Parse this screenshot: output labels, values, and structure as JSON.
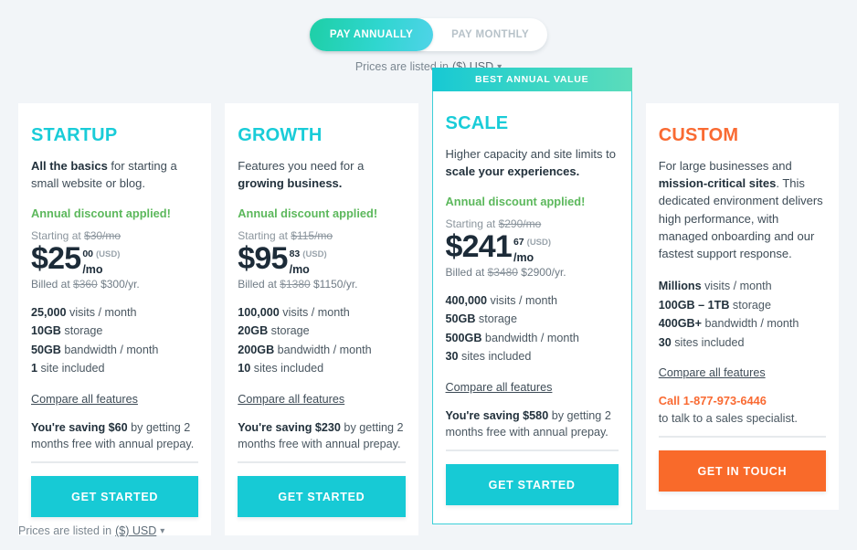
{
  "billing_toggle": {
    "annual_label": "PAY ANNUALLY",
    "monthly_label": "PAY MONTHLY",
    "active": "annual",
    "active_gradient_from": "#1ecfa6",
    "active_gradient_to": "#4fd3e8"
  },
  "currency_note_top": {
    "prefix": "Prices are listed in",
    "currency": "($) USD",
    "caret": "chevron-down"
  },
  "currency_note_bottom": {
    "prefix": "Prices are listed in",
    "currency": "($) USD",
    "caret": "chevron-down"
  },
  "colors": {
    "teal": "#19ccd8",
    "teal_button": "#17cad5",
    "orange": "#f96a32",
    "green": "#5cb85c",
    "page_bg": "#f2f5f8",
    "featured_border": "#3ccfd9"
  },
  "cards": [
    {
      "name": "STARTUP",
      "blurb_bold": "All the basics",
      "blurb_rest": " for starting a small website or blog.",
      "discount": "Annual discount applied!",
      "starting_prefix": "Starting at",
      "starting_struck": "$30/mo",
      "price_main": "$25",
      "price_cents": "00",
      "price_currency": "(USD)",
      "price_period": "/mo",
      "billed_prefix": "Billed at",
      "billed_struck": "$360",
      "billed_now": "$300/yr.",
      "specs": [
        {
          "bold": "25,000",
          "rest": " visits / month"
        },
        {
          "bold": "10GB",
          "rest": " storage"
        },
        {
          "bold": "50GB",
          "rest": " bandwidth / month"
        },
        {
          "bold": "1",
          "rest": " site included"
        }
      ],
      "compare_label": "Compare all features",
      "saving_bold": "You're saving $60",
      "saving_rest": " by getting 2 months free with annual prepay.",
      "cta_label": "GET STARTED",
      "cta_style": "teal",
      "featured": false,
      "banner": null
    },
    {
      "name": "GROWTH",
      "blurb_bold": "growing business.",
      "blurb_prefix": "Features you need for a ",
      "discount": "Annual discount applied!",
      "starting_prefix": "Starting at",
      "starting_struck": "$115/mo",
      "price_main": "$95",
      "price_cents": "83",
      "price_currency": "(USD)",
      "price_period": "/mo",
      "billed_prefix": "Billed at",
      "billed_struck": "$1380",
      "billed_now": "$1150/yr.",
      "specs": [
        {
          "bold": "100,000",
          "rest": " visits / month"
        },
        {
          "bold": "20GB",
          "rest": " storage"
        },
        {
          "bold": "200GB",
          "rest": " bandwidth / month"
        },
        {
          "bold": "10",
          "rest": " sites included"
        }
      ],
      "compare_label": "Compare all features",
      "saving_bold": "You're saving $230",
      "saving_rest": " by getting 2 months free with annual prepay.",
      "cta_label": "GET STARTED",
      "cta_style": "teal",
      "featured": false,
      "banner": null
    },
    {
      "name": "SCALE",
      "blurb_prefix": "Higher capacity and site limits to ",
      "blurb_bold": "scale your experiences.",
      "discount": "Annual discount applied!",
      "starting_prefix": "Starting at",
      "starting_struck": "$290/mo",
      "price_main": "$241",
      "price_cents": "67",
      "price_currency": "(USD)",
      "price_period": "/mo",
      "billed_prefix": "Billed at",
      "billed_struck": "$3480",
      "billed_now": "$2900/yr.",
      "specs": [
        {
          "bold": "400,000",
          "rest": " visits / month"
        },
        {
          "bold": "50GB",
          "rest": " storage"
        },
        {
          "bold": "500GB",
          "rest": " bandwidth / month"
        },
        {
          "bold": "30",
          "rest": " sites included"
        }
      ],
      "compare_label": "Compare all features",
      "saving_bold": "You're saving $580",
      "saving_rest": " by getting 2 months free with annual prepay.",
      "cta_label": "GET STARTED",
      "cta_style": "teal",
      "featured": true,
      "banner": "BEST ANNUAL VALUE"
    },
    {
      "name": "CUSTOM",
      "blurb_prefix": "For large businesses and ",
      "blurb_bold": "mission-critical sites",
      "blurb_suffix": ". This dedicated environment delivers high performance, with managed onboarding and our fastest support response.",
      "specs": [
        {
          "bold": "Millions",
          "rest": " visits / month"
        },
        {
          "bold": "100GB – 1TB",
          "rest": " storage"
        },
        {
          "bold": "400GB+",
          "rest": " bandwidth / month"
        },
        {
          "bold": "30",
          "rest": " sites included"
        }
      ],
      "compare_label": "Compare all features",
      "call_phone": "Call 1-877-973-6446",
      "call_rest": "to talk to a sales specialist.",
      "cta_label": "GET IN TOUCH",
      "cta_style": "orange",
      "featured": false,
      "banner": null
    }
  ]
}
